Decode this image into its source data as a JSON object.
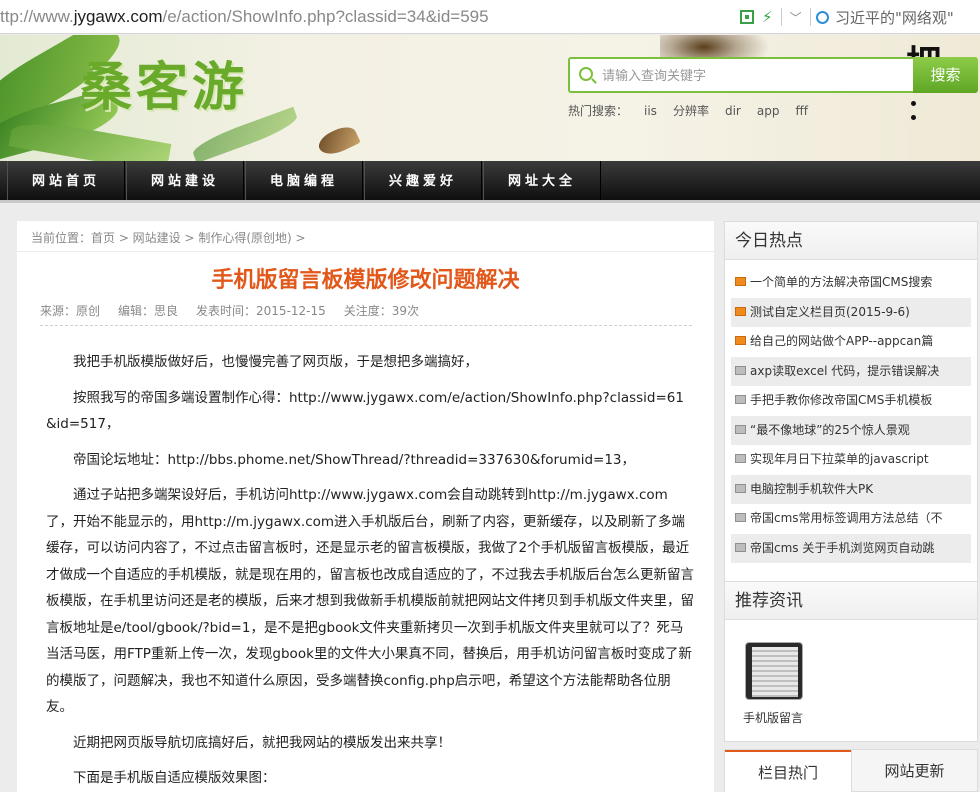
{
  "browser": {
    "url_prefix": "ttp://www.",
    "url_host": "jygawx.com",
    "url_path": "/e/action/ShowInfo.php?classid=34&id=595",
    "search_hint": "习近平的\"网络观\""
  },
  "header": {
    "logo_text": "桑客游",
    "calligraphy": "把",
    "search_placeholder": "请输入查询关键字",
    "search_button": "搜索",
    "hot_label": "热门搜索：",
    "hot_terms": [
      "iis",
      "分辨率",
      "dir",
      "app",
      "fff"
    ]
  },
  "nav": [
    "网站首页",
    "网站建设",
    "电脑编程",
    "兴趣爱好",
    "网址大全"
  ],
  "article": {
    "breadcrumb": "当前位置：首页 > 网站建设 > 制作心得(原创地) >",
    "title": "手机版留言板模版修改问题解决",
    "meta": {
      "source": "来源：原创",
      "editor": "编辑：思良",
      "date": "发表时间：2015-12-15",
      "views": "关注度：39次"
    },
    "paragraphs": [
      "我把手机版模版做好后，也慢慢完善了网页版，于是想把多端搞好，",
      "按照我写的帝国多端设置制作心得：http://www.jygawx.com/e/action/ShowInfo.php?classid=61&id=517，",
      "帝国论坛地址：http://bbs.phome.net/ShowThread/?threadid=337630&forumid=13，",
      "通过子站把多端架设好后，手机访问http://www.jygawx.com会自动跳转到http://m.jygawx.com了，开始不能显示的，用http://m.jygawx.com进入手机版后台，刷新了内容，更新缓存，以及刷新了多端缓存，可以访问内容了，不过点击留言板时，还是显示老的留言板模版，我做了2个手机版留言板模版，最近才做成一个自适应的手机模版，就是现在用的，留言板也改成自适应的了，不过我去手机版后台怎么更新留言板模版，在手机里访问还是老的模版，后来才想到我做新手机模版前就把网站文件拷贝到手机版文件夹里，留言板地址是e/tool/gbook/?bid=1，是不是把gbook文件夹重新拷贝一次到手机版文件夹里就可以了？死马当活马医，用FTP重新上传一次，发现gbook里的文件大小果真不同，替换后，用手机访问留言板时变成了新的模版了，问题解决，我也不知道什么原因，受多端替换config.php启示吧，希望这个方法能帮助各位朋友。",
      "近期把网页版导航切底搞好后，就把我网站的模版发出来共享！",
      "下面是手机版自适应模版效果图："
    ]
  },
  "sidebar": {
    "hot_title": "今日热点",
    "hot_items": [
      {
        "text": "一个简单的方法解决帝国CMS搜索",
        "rank": "top"
      },
      {
        "text": "测试自定义栏目页(2015-9-6)",
        "rank": "top"
      },
      {
        "text": "给自己的网站做个APP--appcan篇",
        "rank": "top"
      },
      {
        "text": "axp读取excel 代码，提示错误解决",
        "rank": "normal"
      },
      {
        "text": "手把手教你修改帝国CMS手机模板",
        "rank": "normal"
      },
      {
        "text": "“最不像地球”的25个惊人景观",
        "rank": "normal"
      },
      {
        "text": "实现年月日下拉菜单的javascript",
        "rank": "normal"
      },
      {
        "text": "电脑控制手机软件大PK",
        "rank": "normal"
      },
      {
        "text": "帝国cms常用标签调用方法总结（不",
        "rank": "normal"
      },
      {
        "text": "帝国cms 关于手机浏览网页自动跳",
        "rank": "normal"
      }
    ],
    "rec_title": "推荐资讯",
    "rec_caption": "手机版留言",
    "tabs": [
      "栏目热门",
      "网站更新"
    ]
  },
  "colors": {
    "accent": "#e2581a",
    "brand_green": "#7bbf3c",
    "nav_bg": "#1c1c1c"
  }
}
